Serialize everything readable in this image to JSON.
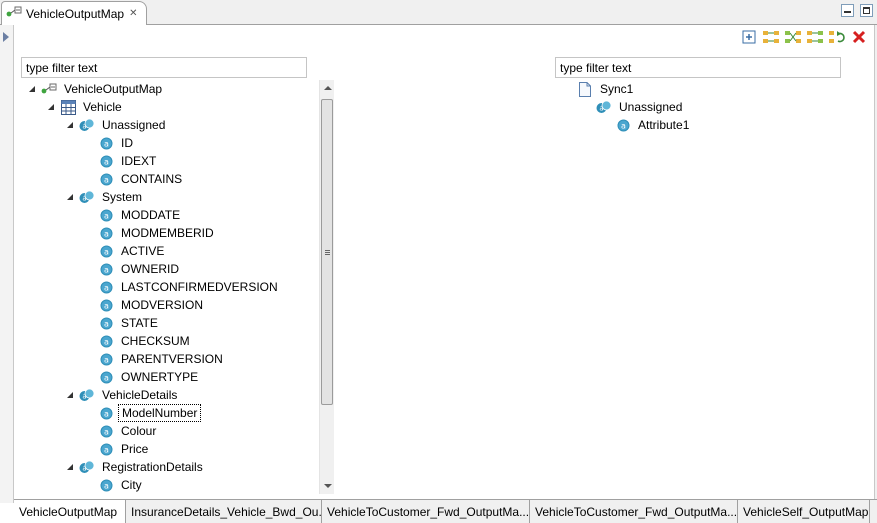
{
  "editor": {
    "tab_title": "VehicleOutputMap",
    "tab_close": "✕"
  },
  "toolbar": {
    "buttons": [
      "expand-all-icon",
      "connect-icon",
      "auto-map-icon",
      "map-children-icon",
      "refresh-map-icon",
      "delete-map-icon"
    ]
  },
  "left_panel": {
    "filter_placeholder": "type filter text",
    "tree": [
      {
        "label": "VehicleOutputMap",
        "icon": "map-icon",
        "depth": 0,
        "expanded": true
      },
      {
        "label": "Vehicle",
        "icon": "table-icon",
        "depth": 1,
        "expanded": true
      },
      {
        "label": "Unassigned",
        "icon": "attribute-group-icon",
        "depth": 2,
        "expanded": true
      },
      {
        "label": "ID",
        "icon": "attribute-icon",
        "depth": 3
      },
      {
        "label": "IDEXT",
        "icon": "attribute-icon",
        "depth": 3
      },
      {
        "label": "CONTAINS",
        "icon": "attribute-icon",
        "depth": 3
      },
      {
        "label": "System",
        "icon": "attribute-group-icon",
        "depth": 2,
        "expanded": true
      },
      {
        "label": "MODDATE",
        "icon": "attribute-icon",
        "depth": 3
      },
      {
        "label": "MODMEMBERID",
        "icon": "attribute-icon",
        "depth": 3
      },
      {
        "label": "ACTIVE",
        "icon": "attribute-icon",
        "depth": 3
      },
      {
        "label": "OWNERID",
        "icon": "attribute-icon",
        "depth": 3
      },
      {
        "label": "LASTCONFIRMEDVERSION",
        "icon": "attribute-icon",
        "depth": 3
      },
      {
        "label": "MODVERSION",
        "icon": "attribute-icon",
        "depth": 3
      },
      {
        "label": "STATE",
        "icon": "attribute-icon",
        "depth": 3
      },
      {
        "label": "CHECKSUM",
        "icon": "attribute-icon",
        "depth": 3
      },
      {
        "label": "PARENTVERSION",
        "icon": "attribute-icon",
        "depth": 3
      },
      {
        "label": "OWNERTYPE",
        "icon": "attribute-icon",
        "depth": 3
      },
      {
        "label": "VehicleDetails",
        "icon": "attribute-group-icon",
        "depth": 2,
        "expanded": true
      },
      {
        "label": "ModelNumber",
        "icon": "attribute-icon",
        "depth": 3,
        "selected": true
      },
      {
        "label": "Colour",
        "icon": "attribute-icon",
        "depth": 3
      },
      {
        "label": "Price",
        "icon": "attribute-icon",
        "depth": 3
      },
      {
        "label": "RegistrationDetails",
        "icon": "attribute-group-icon",
        "depth": 2,
        "expanded": true
      },
      {
        "label": "City",
        "icon": "attribute-icon",
        "depth": 3
      }
    ]
  },
  "right_panel": {
    "filter_placeholder": "type filter text",
    "tree": [
      {
        "label": "Sync1",
        "icon": "document-icon",
        "depth": 0
      },
      {
        "label": "Unassigned",
        "icon": "attribute-group-icon",
        "depth": 1
      },
      {
        "label": "Attribute1",
        "icon": "attribute-icon",
        "depth": 2
      }
    ]
  },
  "bottom_tabs": [
    {
      "label": "VehicleOutputMap",
      "active": true
    },
    {
      "label": "InsuranceDetails_Vehicle_Bwd_Ou..."
    },
    {
      "label": "VehicleToCustomer_Fwd_OutputMa..."
    },
    {
      "label": "VehicleToCustomer_Fwd_OutputMa..."
    },
    {
      "label": "VehicleSelf_OutputMap"
    }
  ],
  "colors": {
    "attribute_icon": "#2f8fb8",
    "accent": "#3a6ea5",
    "delete": "#d62020"
  }
}
